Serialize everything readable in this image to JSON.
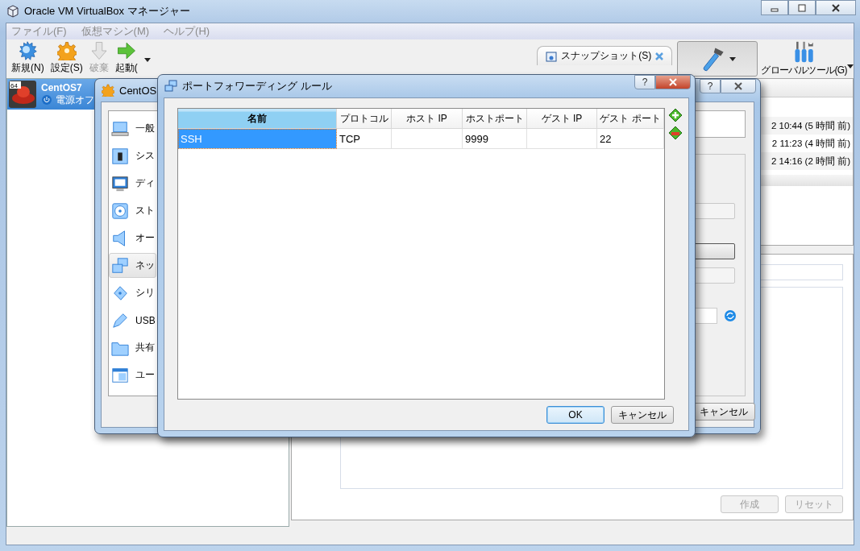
{
  "main_window": {
    "title": "Oracle VM VirtualBox マネージャー",
    "menu": [
      "ファイル(F)",
      "仮想マシン(M)",
      "ヘルプ(H)"
    ],
    "toolbar": [
      {
        "label": "新規(N)",
        "kind": "new",
        "disabled": false
      },
      {
        "label": "設定(S)",
        "kind": "settings",
        "disabled": false
      },
      {
        "label": "破棄",
        "kind": "discard",
        "disabled": true
      },
      {
        "label": "起動(",
        "kind": "start",
        "disabled": false
      }
    ],
    "snapshot_tab": {
      "label": "スナップショット(S)"
    },
    "tools_button": {
      "selected": true
    },
    "global_tools": {
      "label": "グローバルツール(G)"
    },
    "vm_list": [
      {
        "name": "CentOS7",
        "badge": "64",
        "state": "電源オフ",
        "selected": true
      }
    ],
    "snapshots": [
      {
        "time": "2 10:44 (5 時間 前)"
      },
      {
        "time": "2 11:23 (4 時間 前)"
      },
      {
        "time": "2 14:16 (2 時間 前)"
      }
    ],
    "detail_buttons": [
      {
        "label": "作成",
        "disabled": true
      },
      {
        "label": "リセット",
        "disabled": true
      }
    ]
  },
  "settings_dialog": {
    "title": "CentOS",
    "help": "?",
    "sections": [
      {
        "label": "一般",
        "kind": "general",
        "selected": false
      },
      {
        "label": "シス",
        "kind": "system",
        "selected": false
      },
      {
        "label": "ディ",
        "kind": "display",
        "selected": false
      },
      {
        "label": "スト",
        "kind": "storage",
        "selected": false
      },
      {
        "label": "オー",
        "kind": "audio",
        "selected": false
      },
      {
        "label": "ネッ",
        "kind": "network",
        "selected": true
      },
      {
        "label": "シリ",
        "kind": "serial",
        "selected": false
      },
      {
        "label": "USB",
        "kind": "usb",
        "selected": false
      },
      {
        "label": "共有",
        "kind": "folder",
        "selected": false
      },
      {
        "label": "ユー",
        "kind": "ui",
        "selected": false
      }
    ],
    "buttons": [
      "キャンセル"
    ]
  },
  "port_dialog": {
    "title": "ポートフォワーディング ルール",
    "help": "?",
    "columns": [
      {
        "label": "名前"
      },
      {
        "label": "プロトコル"
      },
      {
        "label": "ホスト IP"
      },
      {
        "label": "ホストポート"
      },
      {
        "label": "ゲスト IP"
      },
      {
        "label": "ゲスト ポート"
      }
    ],
    "rows": [
      {
        "cells": [
          {
            "text": "SSH"
          },
          {
            "text": "TCP"
          },
          {},
          {
            "text": "9999"
          },
          {},
          {
            "text": "22"
          }
        ],
        "selected": true
      }
    ],
    "buttons": [
      {
        "label": "OK",
        "default": true
      },
      {
        "label": "キャンセル",
        "default": false
      }
    ]
  }
}
